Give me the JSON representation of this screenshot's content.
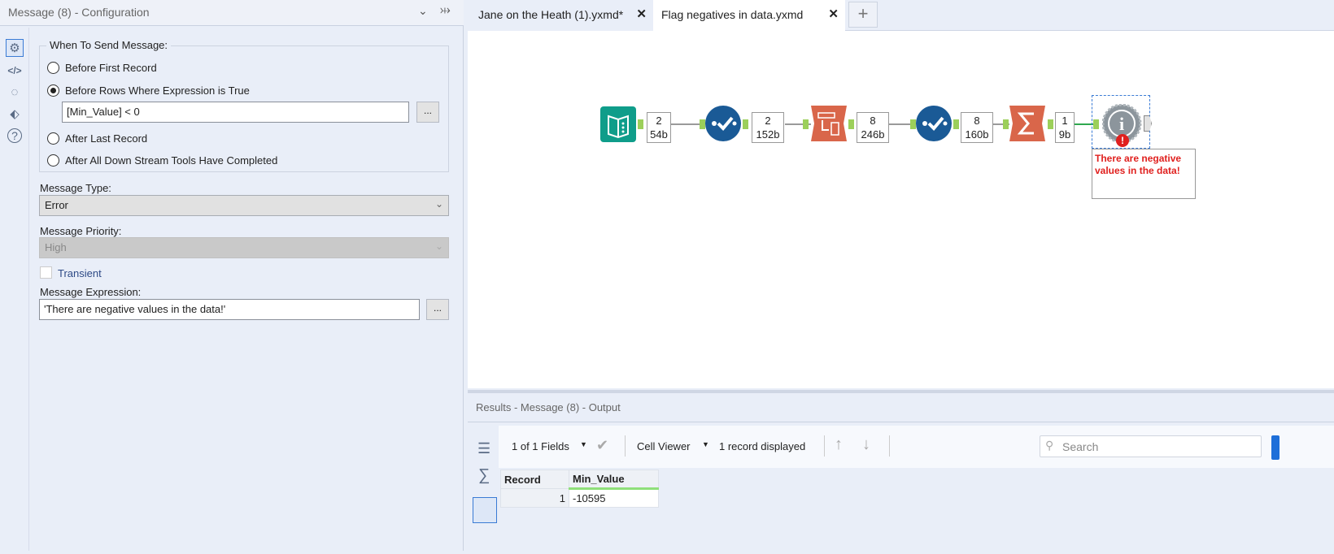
{
  "config": {
    "title": "Message (8) - Configuration",
    "group_label": "When To Send Message:",
    "options": [
      "Before First Record",
      "Before Rows Where Expression is True",
      "After Last Record",
      "After All Down Stream Tools Have Completed"
    ],
    "selected_option": 1,
    "expression": "[Min_Value] < 0",
    "ellipsis": "...",
    "message_type_label": "Message Type:",
    "message_type": "Error",
    "priority_label": "Message Priority:",
    "priority": "High",
    "transient_label": "Transient",
    "transient_checked": false,
    "message_expression_label": "Message Expression:",
    "message_expression": "'There are negative values in the data!'"
  },
  "tabs": [
    {
      "label": "Jane on the Heath (1).yxmd*",
      "active": false
    },
    {
      "label": "Flag negatives in data.yxmd",
      "active": true
    }
  ],
  "workflow": {
    "counts": [
      {
        "records": "2",
        "size": "54b"
      },
      {
        "records": "2",
        "size": "152b"
      },
      {
        "records": "8",
        "size": "246b"
      },
      {
        "records": "8",
        "size": "160b"
      },
      {
        "records": "1",
        "size": "9b"
      }
    ],
    "annotation": "There are negative values in the data!",
    "error_icon": "!"
  },
  "results": {
    "title": "Results - Message (8) - Output",
    "fields": "1 of 1 Fields",
    "cell_viewer": "Cell Viewer",
    "records_displayed": "1 record displayed",
    "search_placeholder": "Search",
    "columns": [
      "Record",
      "Min_Value"
    ],
    "rows": [
      [
        "1",
        "-10595"
      ]
    ]
  },
  "colors": {
    "accent": "#1e6fd9",
    "teal": "#0f9d8a",
    "blue_tool": "#1a5a96",
    "orange_tool": "#d9664a",
    "error": "#e0201e"
  }
}
